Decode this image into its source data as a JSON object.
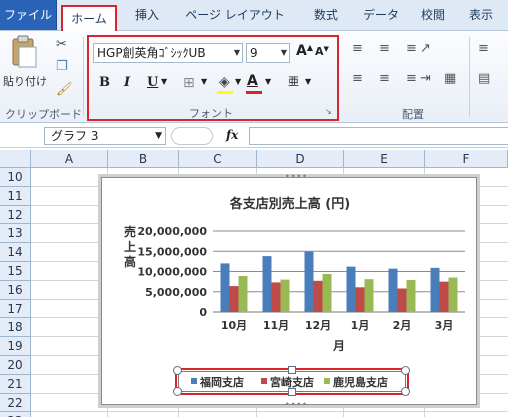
{
  "ribbon": {
    "tabs": [
      "ファイル",
      "ホーム",
      "挿入",
      "ページ レイアウト",
      "数式",
      "データ",
      "校閲",
      "表示"
    ],
    "clipboard": {
      "paste_label": "貼り付け",
      "group_label": "クリップボード"
    },
    "font": {
      "family": "HGP創英角ｺﾞｼｯｸUB",
      "size": "9",
      "bold": "B",
      "italic": "I",
      "underline": "U",
      "grow": "A",
      "shrink": "A",
      "font_color": "A",
      "phonetic": "亜",
      "group_label": "フォント"
    },
    "alignment": {
      "group_label": "配置"
    }
  },
  "formula_bar": {
    "name_box": "グラフ 3",
    "fx": "fx",
    "formula": ""
  },
  "grid": {
    "columns": [
      "A",
      "B",
      "C",
      "D",
      "E",
      "F"
    ],
    "rows": [
      "10",
      "11",
      "12",
      "13",
      "14",
      "15",
      "16",
      "17",
      "18",
      "19",
      "20",
      "21",
      "22",
      "23"
    ]
  },
  "chart_data": {
    "type": "bar",
    "title": "各支店別売上高 (円)",
    "xlabel": "月",
    "ylabel": "売上高",
    "categories": [
      "10月",
      "11月",
      "12月",
      "1月",
      "2月",
      "3月"
    ],
    "ylim": [
      0,
      20000000
    ],
    "yticks": [
      "20,000,000",
      "15,000,000",
      "10,000,000",
      "5,000,000",
      "0"
    ],
    "grid": true,
    "legend_position": "bottom",
    "series": [
      {
        "name": "福岡支店",
        "color": "#4a7ebb",
        "values": [
          12000000,
          13800000,
          14900000,
          11200000,
          10700000,
          10900000
        ]
      },
      {
        "name": "宮崎支店",
        "color": "#be4b48",
        "values": [
          6400000,
          7300000,
          7700000,
          6100000,
          5800000,
          7500000
        ]
      },
      {
        "name": "鹿児島支店",
        "color": "#98b954",
        "values": [
          8900000,
          8000000,
          9400000,
          8100000,
          7900000,
          8500000
        ]
      }
    ]
  }
}
